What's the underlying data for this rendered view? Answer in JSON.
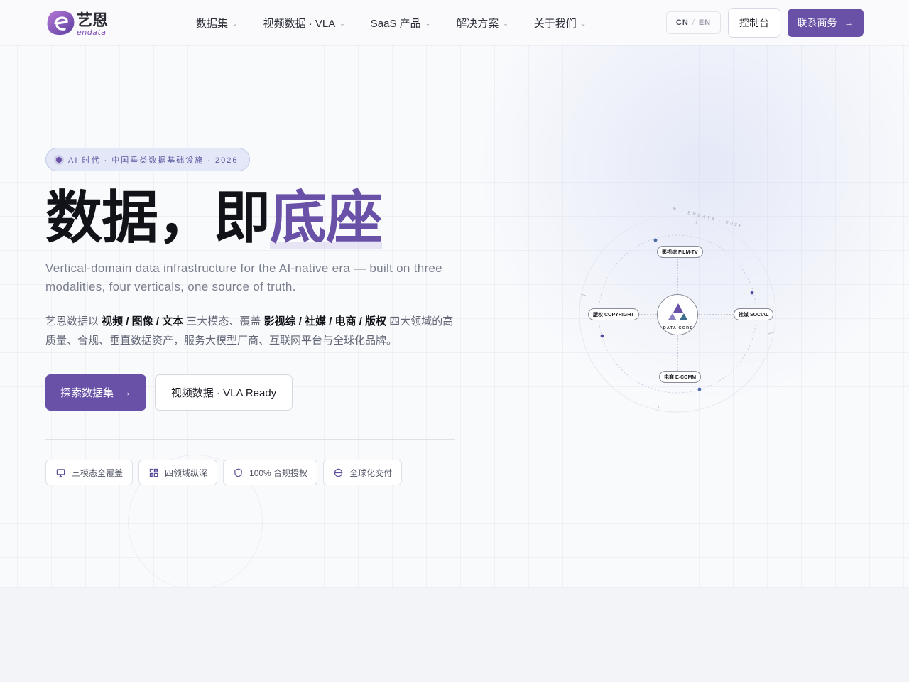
{
  "colors": {
    "brand": "#6951a8",
    "background": "#f9fafc",
    "text": "#111318",
    "muted": "#7a7f8e",
    "pill_bg": "#e3e7f7"
  },
  "header": {
    "logo": {
      "cn": "艺恩",
      "en": "endata"
    },
    "nav": [
      {
        "label": "数据集",
        "icon": "chevron-down-icon"
      },
      {
        "label": "视频数据 · VLA",
        "icon": "chevron-down-icon"
      },
      {
        "label": "SaaS 产品",
        "icon": "chevron-down-icon"
      },
      {
        "label": "解决方案",
        "icon": "chevron-down-icon"
      },
      {
        "label": "关于我们",
        "icon": "chevron-down-icon"
      }
    ],
    "lang": {
      "cn": "CN",
      "separator": "/",
      "en": "EN"
    },
    "console_label": "控制台",
    "contact_label": "联系商务",
    "contact_arrow": "→"
  },
  "hero": {
    "pill": "AI 时代 · 中国垂类数据基础设施 · 2026",
    "headline_main": "数据，即",
    "headline_accent": "底座",
    "subtitle_en": "Vertical-domain data infrastructure for the AI-native era — built on three modalities, four verticals, one source of truth.",
    "desc": {
      "t1": "艺恩数据以 ",
      "b1": "视频 / 图像 / 文本",
      "t2": " 三大模态、覆盖 ",
      "b2": "影视综 / 社媒 / 电商 / 版权",
      "t3": " 四大领域的高质量、合规、垂直数据资产，服务大模型厂商、互联网平台与全球化品牌。"
    },
    "primary_cta": "探索数据集",
    "primary_arrow": "→",
    "secondary_cta": "视频数据 · VLA Ready",
    "features": [
      {
        "label": "三模态全覆盖",
        "icon": "monitor-icon"
      },
      {
        "label": "四领域纵深",
        "icon": "grid-icon"
      },
      {
        "label": "100% 合规授权",
        "icon": "shield-icon"
      },
      {
        "label": "全球化交付",
        "icon": "globe-icon"
      }
    ]
  },
  "diagram": {
    "orbit_text": "N · ENDATA · 2026",
    "core_label": "DATA CORE",
    "nodes": {
      "top": "影视综 FILM-TV",
      "left": "版权 COPYRIGHT",
      "right": "社媒 SOCIAL",
      "bottom": "电商 E-COMM"
    }
  }
}
